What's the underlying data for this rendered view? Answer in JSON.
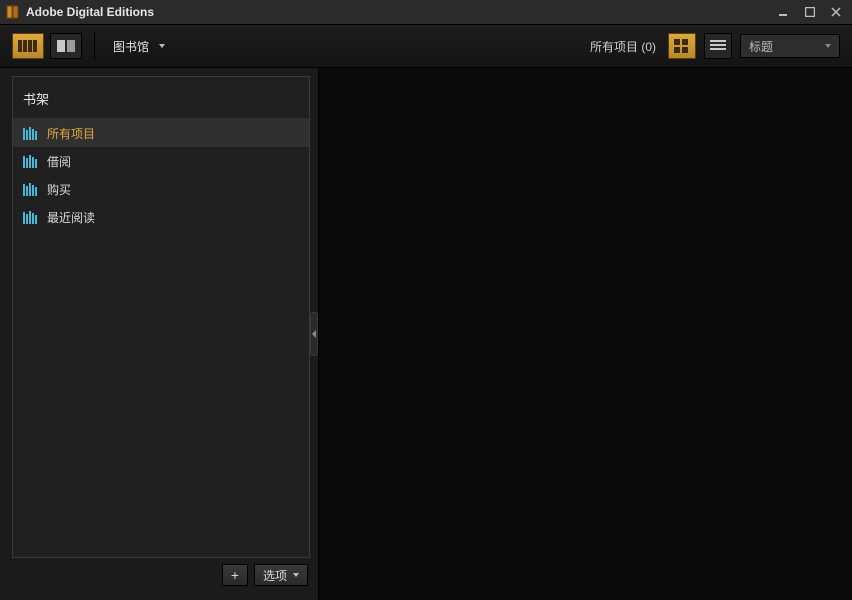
{
  "window": {
    "title": "Adobe Digital Editions"
  },
  "toolbar": {
    "library_menu": "图书馆",
    "status_label": "所有项目",
    "status_count": "(0)",
    "sort_label": "标题"
  },
  "sidebar": {
    "header": "书架",
    "items": [
      {
        "label": "所有项目",
        "selected": true
      },
      {
        "label": "借阅",
        "selected": false
      },
      {
        "label": "购买",
        "selected": false
      },
      {
        "label": "最近阅读",
        "selected": false
      }
    ],
    "footer": {
      "add_label": "+",
      "options_label": "选项"
    }
  },
  "colors": {
    "accent": "#e0a93f"
  }
}
